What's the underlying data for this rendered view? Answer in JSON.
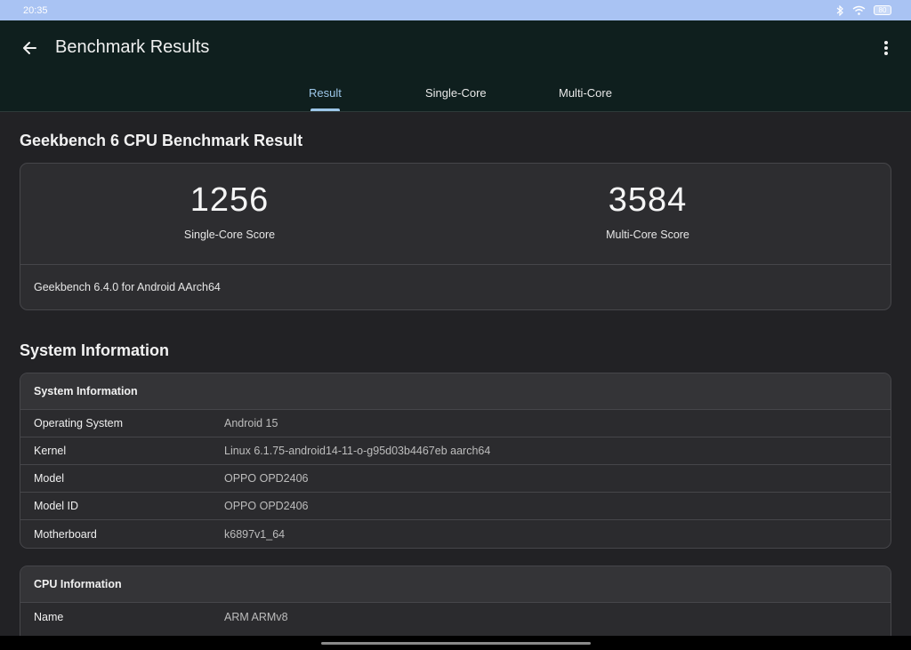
{
  "status_bar": {
    "time": "20:35",
    "battery": "80"
  },
  "header": {
    "title": "Benchmark Results"
  },
  "tabs": [
    {
      "label": "Result",
      "active": true
    },
    {
      "label": "Single-Core",
      "active": false
    },
    {
      "label": "Multi-Core",
      "active": false
    }
  ],
  "result": {
    "title": "Geekbench 6 CPU Benchmark Result",
    "single_core_score": "1256",
    "single_core_label": "Single-Core Score",
    "multi_core_score": "3584",
    "multi_core_label": "Multi-Core Score",
    "version": "Geekbench 6.4.0 for Android AArch64"
  },
  "system_section": {
    "title": "System Information",
    "card_title": "System Information",
    "rows": [
      {
        "key": "Operating System",
        "value": "Android 15"
      },
      {
        "key": "Kernel",
        "value": "Linux 6.1.75-android14-11-o-g95d03b4467eb aarch64"
      },
      {
        "key": "Model",
        "value": "OPPO OPD2406"
      },
      {
        "key": "Model ID",
        "value": "OPPO OPD2406"
      },
      {
        "key": "Motherboard",
        "value": "k6897v1_64"
      }
    ]
  },
  "cpu_section": {
    "card_title": "CPU Information",
    "rows": [
      {
        "key": "Name",
        "value": "ARM ARMv8"
      }
    ]
  },
  "colors": {
    "background": "#222225",
    "header_bg": "#0f1f1e",
    "status_bar_bg": "#a9c3f3",
    "accent": "#9cc6e8",
    "card_bg": "#2d2d30"
  },
  "icons": {
    "back": "arrow-left-icon",
    "menu": "more-vert-icon",
    "bluetooth": "bluetooth-icon",
    "wifi": "wifi-icon",
    "battery": "battery-icon"
  }
}
